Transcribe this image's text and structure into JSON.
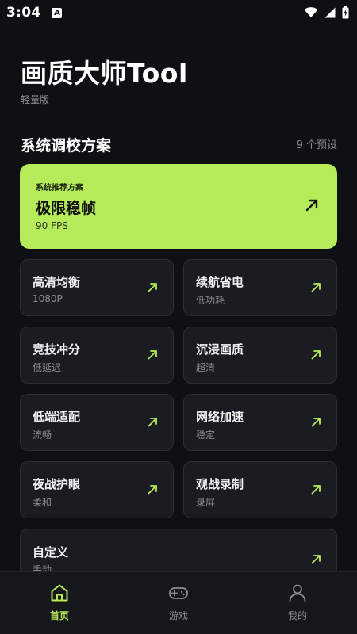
{
  "status_bar": {
    "time": "3:04",
    "notification_badge": "A"
  },
  "header": {
    "title": "画质大师Tool",
    "subtitle": "轻量版"
  },
  "section": {
    "title": "系统调校方案",
    "count": "9 个预设"
  },
  "featured": {
    "tag": "系统推荐方案",
    "name": "极限稳帧",
    "fps": "90 FPS"
  },
  "presets": [
    {
      "name": "高清均衡",
      "sub": "1080P"
    },
    {
      "name": "续航省电",
      "sub": "低功耗"
    },
    {
      "name": "竞技冲分",
      "sub": "低延迟"
    },
    {
      "name": "沉浸画质",
      "sub": "超清"
    },
    {
      "name": "低端适配",
      "sub": "流畅"
    },
    {
      "name": "网络加速",
      "sub": "稳定"
    },
    {
      "name": "夜战护眼",
      "sub": "柔和"
    },
    {
      "name": "观战录制",
      "sub": "录屏"
    },
    {
      "name": "自定义",
      "sub": "手动"
    }
  ],
  "nav": [
    {
      "label": "首页",
      "icon": "home-icon",
      "active": true
    },
    {
      "label": "游戏",
      "icon": "gamepad-icon",
      "active": false
    },
    {
      "label": "我的",
      "icon": "user-icon",
      "active": false
    }
  ],
  "colors": {
    "accent": "#b6ec5a",
    "background": "#0f1013",
    "card": "#1a1c21",
    "muted": "#8b8e95"
  }
}
